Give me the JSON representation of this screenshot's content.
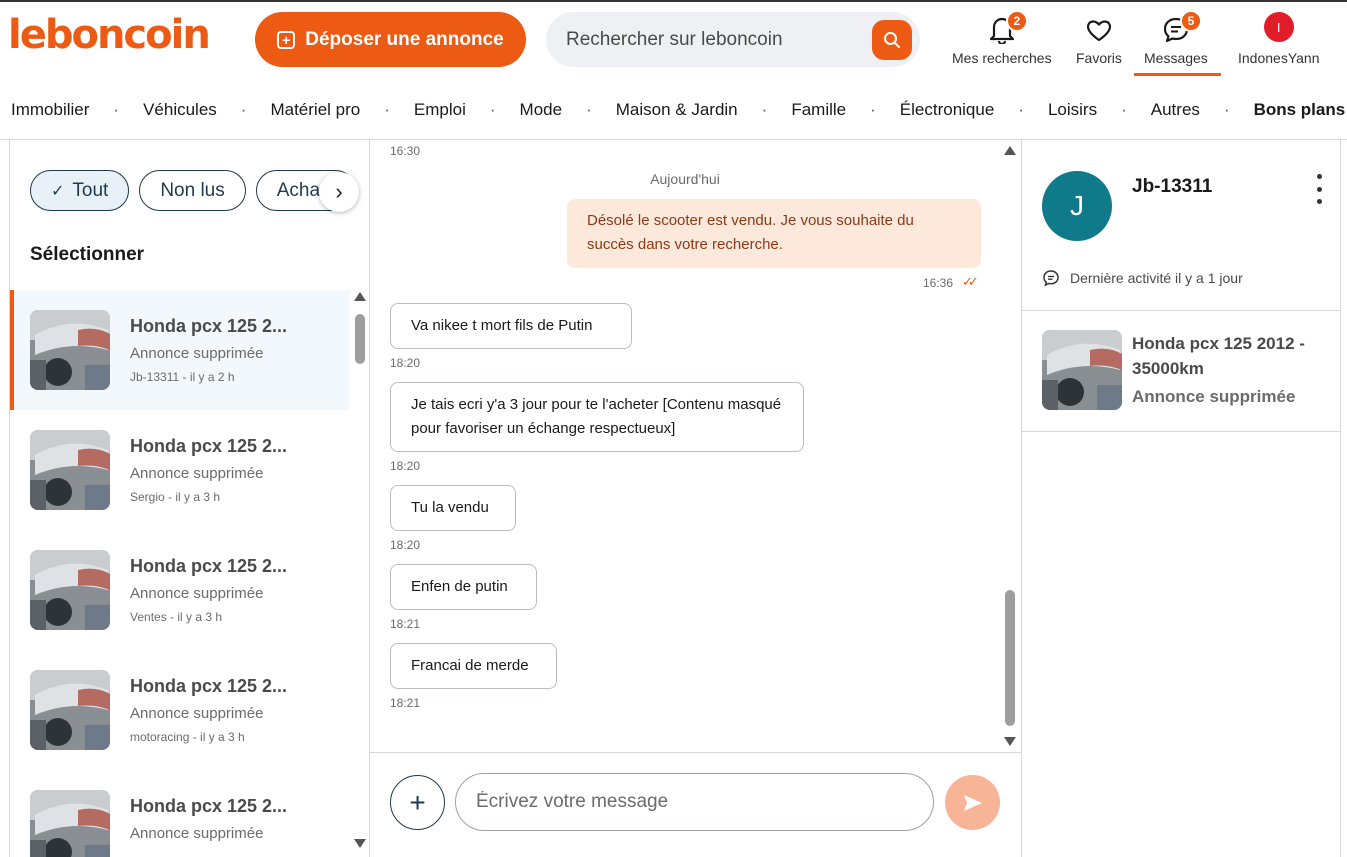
{
  "header": {
    "logo": "leboncoin",
    "deposit_label": "Déposer une annonce",
    "search_placeholder": "Rechercher sur leboncoin",
    "nav": {
      "searches": {
        "label": "Mes recherches",
        "badge": "2"
      },
      "favorites": {
        "label": "Favoris"
      },
      "messages": {
        "label": "Messages",
        "badge": "5"
      },
      "user": {
        "label": "IndonesYann",
        "initial": "I"
      }
    }
  },
  "categories": [
    "Immobilier",
    "Véhicules",
    "Matériel pro",
    "Emploi",
    "Mode",
    "Maison & Jardin",
    "Famille",
    "Électronique",
    "Loisirs",
    "Autres",
    "Bons plans !"
  ],
  "sidebar": {
    "filters": [
      "Tout",
      "Non lus",
      "Achats"
    ],
    "select_title": "Sélectionner",
    "conversations": [
      {
        "title": "Honda pcx 125 2...",
        "subtitle": "Annonce supprimée",
        "meta": "Jb-13311 - il y a 2 h"
      },
      {
        "title": "Honda pcx 125 2...",
        "subtitle": "Annonce supprimée",
        "meta": "Sergio - il y a 3 h"
      },
      {
        "title": "Honda pcx 125 2...",
        "subtitle": "Annonce supprimée",
        "meta": "Ventes - il y a 3 h"
      },
      {
        "title": "Honda pcx 125 2...",
        "subtitle": "Annonce supprimée",
        "meta": "motoracing - il y a 3 h"
      },
      {
        "title": "Honda pcx 125 2...",
        "subtitle": "Annonce supprimée",
        "meta": ""
      }
    ]
  },
  "chat": {
    "top_time": "16:30",
    "day_label": "Aujourd'hui",
    "outgoing": {
      "text": "Désolé le scooter est vendu. Je vous souhaite du succès dans votre recherche.",
      "time": "16:36"
    },
    "messages": [
      {
        "text": "Va nikee t mort fils de Putin",
        "time": "18:20"
      },
      {
        "text": "Je tais ecri y'a 3 jour pour te l'acheter [Contenu masqué pour favoriser un échange respectueux]",
        "time": "18:20"
      },
      {
        "text": "Tu la vendu",
        "time": "18:20"
      },
      {
        "text": "Enfen de putin",
        "time": "18:21"
      },
      {
        "text": "Francai de merde",
        "time": "18:21"
      }
    ],
    "composer_placeholder": "Écrivez votre message"
  },
  "profile": {
    "initial": "J",
    "name": "Jb-13311",
    "activity": "Dernière activité il y a 1 jour",
    "item_title": "Honda pcx 125 2012 - 35000km",
    "item_status": "Annonce supprimée"
  },
  "colors": {
    "brand": "#ec5a13",
    "navy": "#1f3a4d",
    "avatar_teal": "#0f7a8a",
    "outgoing_bubble": "#fde8dc"
  }
}
